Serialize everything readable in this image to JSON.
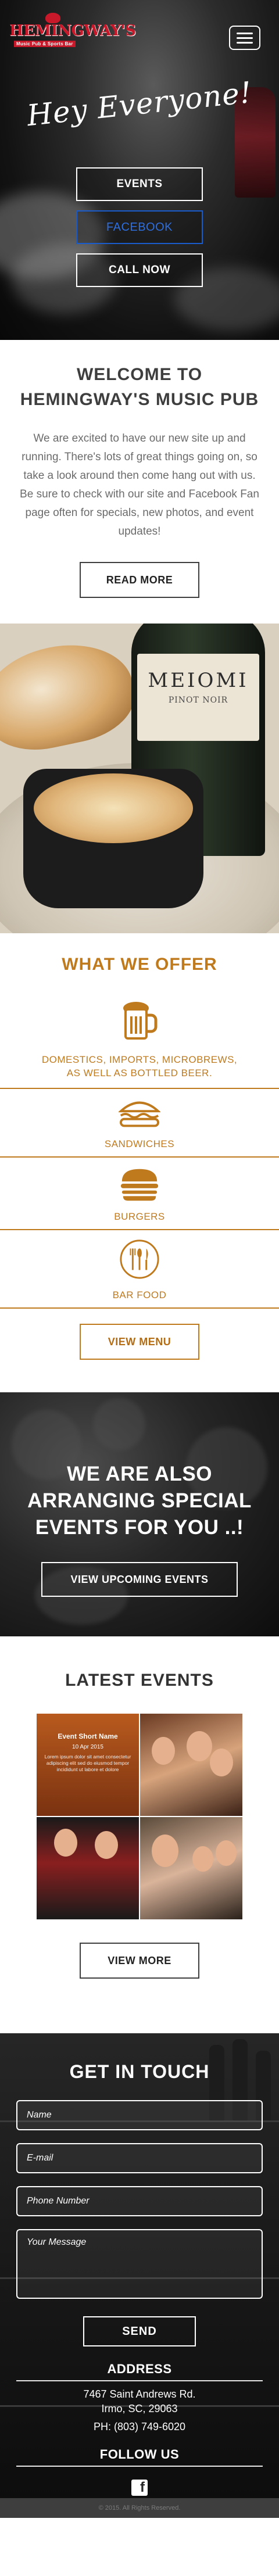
{
  "header": {
    "logo_name": "HEMINGWAY'S",
    "logo_tagline": "Music Pub & Sports Bar",
    "menu_icon": "hamburger-menu-icon"
  },
  "hero": {
    "title": "Hey Everyone!",
    "buttons": [
      "EVENTS",
      "FACEBOOK",
      "CALL NOW"
    ]
  },
  "welcome": {
    "title_line1": "WELCOME TO",
    "title_line2": "HEMINGWAY'S MUSIC PUB",
    "body": "We are excited to have our new site up and running. There's lots of great things going on, so take a look around then come hang out with us. Be sure to check with our site and Facebook Fan page often for specials, new photos, and event updates!",
    "button": "READ MORE"
  },
  "food_photo": {
    "bottle_label_1": "MEIOMI",
    "bottle_label_2": "PINOT NOIR"
  },
  "offer": {
    "title": "WHAT WE OFFER",
    "items": [
      {
        "icon": "beer-mug-icon",
        "label_line1": "DOMESTICS, IMPORTS, MICROBREWS,",
        "label_line2": "AS WELL AS BOTTLED BEER."
      },
      {
        "icon": "sandwich-icon",
        "label_line1": "SANDWICHES",
        "label_line2": ""
      },
      {
        "icon": "burger-icon",
        "label_line1": "BURGERS",
        "label_line2": ""
      },
      {
        "icon": "bar-food-icon",
        "label_line1": "BAR FOOD",
        "label_line2": ""
      }
    ],
    "button": "VIEW MENU",
    "accent_color": "#c07a1e"
  },
  "special": {
    "line1": "WE ARE ALSO",
    "line2": "ARRANGING SPECIAL",
    "line3": "EVENTS FOR YOU ..!",
    "button": "VIEW UPCOMING EVENTS"
  },
  "latest": {
    "title": "LATEST EVENTS",
    "event_name": "Event Short Name",
    "event_date": "10 Apr 2015",
    "event_text": "Lorem ipsum dolor sit amet consectetur adipiscing elit sed do eiusmod tempor incididunt ut labore et dolore",
    "button": "VIEW MORE"
  },
  "contact": {
    "title": "GET IN TOUCH",
    "fields": {
      "name": "Name",
      "email": "E-mail",
      "phone": "Phone Number",
      "message": "Your Message"
    },
    "send": "SEND",
    "address_title": "ADDRESS",
    "address_line1": "7467 Saint Andrews Rd.",
    "address_line2": "Irmo, SC, 29063",
    "phone": "PH: (803) 749-6020",
    "follow_title": "FOLLOW US",
    "facebook_icon": "facebook-icon"
  },
  "footer": {
    "text": "© 2015. All Rights Reserved."
  }
}
